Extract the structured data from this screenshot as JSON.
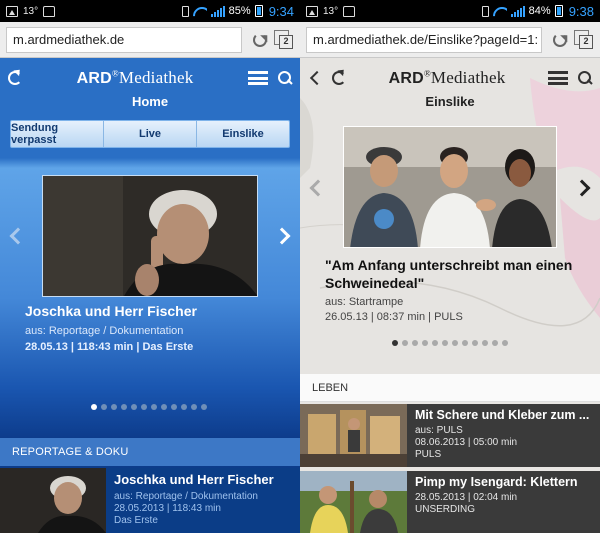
{
  "status_left": {
    "temp": "13°",
    "battery": "85%",
    "clock": "9:34"
  },
  "status_right": {
    "temp": "13°",
    "battery": "84%",
    "clock": "9:38"
  },
  "left": {
    "url": "m.ardmediathek.de",
    "tabs_count": "2",
    "logo": {
      "ard": "ARD",
      "reg": "®",
      "mediathek": "Mediathek"
    },
    "page_title": "Home",
    "nav": [
      {
        "label": "Sendung verpasst"
      },
      {
        "label": "Live"
      },
      {
        "label": "Einslike"
      }
    ],
    "featured": {
      "title": "Joschka und Herr Fischer",
      "source": "aus: Reportage / Dokumentation",
      "info": "28.05.13 | 118:43 min | Das Erste"
    },
    "section": "REPORTAGE & DOKU",
    "list": [
      {
        "title": "Joschka und Herr Fischer",
        "source": "aus: Reportage / Dokumentation",
        "info": "28.05.2013 | 118:43 min",
        "channel": "Das Erste"
      }
    ]
  },
  "right": {
    "url": "m.ardmediathek.de/Einslike?pageId=1:",
    "tabs_count": "2",
    "logo": {
      "ard": "ARD",
      "reg": "®",
      "mediathek": "Mediathek"
    },
    "page_title": "Einslike",
    "featured": {
      "title": "\"Am Anfang unterschreibt man einen Schweinedeal\"",
      "source": "aus: Startrampe",
      "info": "26.05.13 | 08:37 min | PULS"
    },
    "section": "LEBEN",
    "list": [
      {
        "title": "Mit Schere und Kleber zum ...",
        "source": "aus: PULS",
        "info": "08.06.2013 | 05:00 min",
        "channel": "PULS"
      },
      {
        "title": "Pimp my Isengard: Klettern",
        "info": "28.05.2013 | 02:04 min",
        "channel": "UNSERDING"
      }
    ]
  },
  "colors": {
    "ard_blue": "#2a6fc5",
    "dark_navy": "#0b3a86",
    "clock_blue": "#35a2ff",
    "list_dark": "#3a3a3a"
  }
}
